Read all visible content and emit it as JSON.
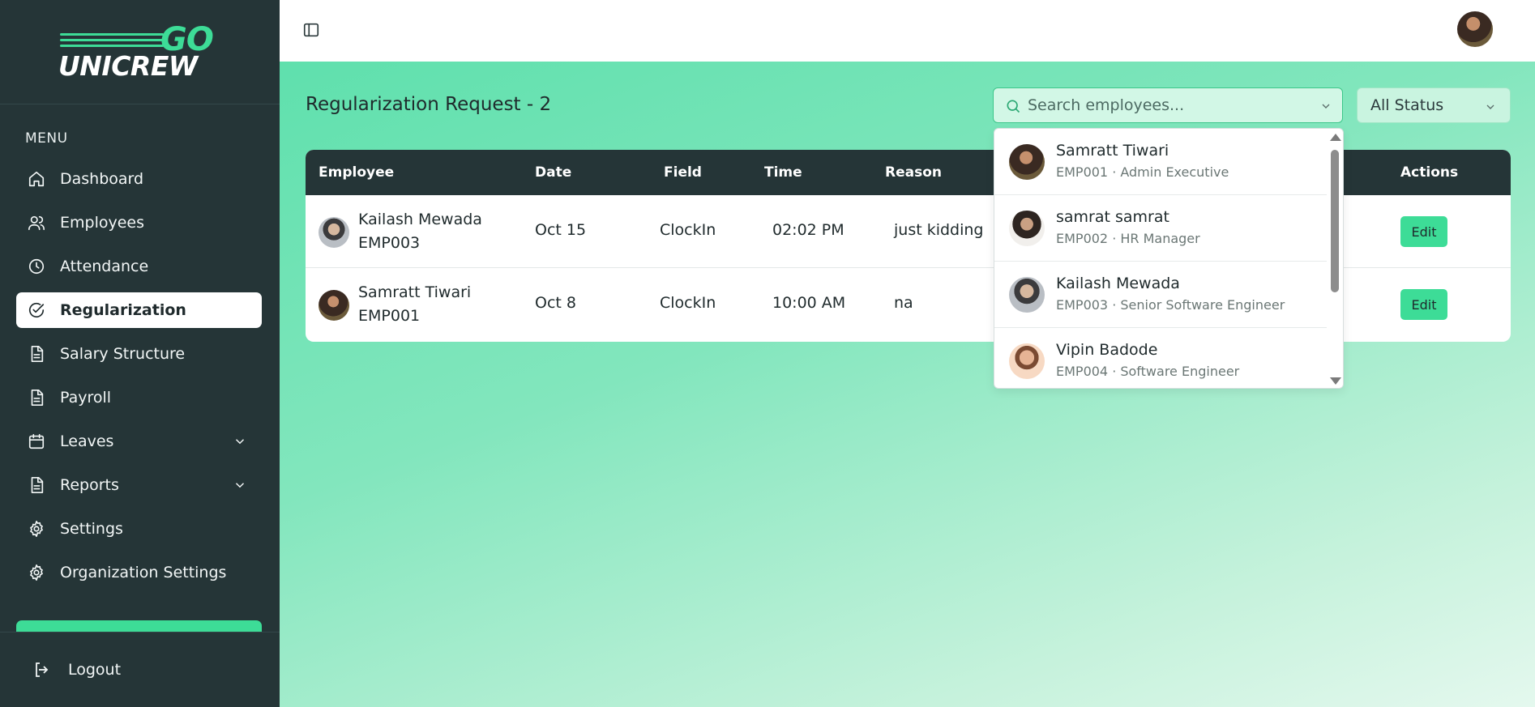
{
  "brand": {
    "logo_go": "GO",
    "logo_name": "UNICREW",
    "accent": "#3ddc97",
    "sidebar_bg": "#253537"
  },
  "sidebar": {
    "menu_label": "MENU",
    "items": [
      {
        "label": "Dashboard",
        "icon": "home-icon",
        "active": false
      },
      {
        "label": "Employees",
        "icon": "users-icon",
        "active": false
      },
      {
        "label": "Attendance",
        "icon": "clock-icon",
        "active": false
      },
      {
        "label": "Regularization",
        "icon": "check-circle-icon",
        "active": true
      },
      {
        "label": "Salary Structure",
        "icon": "document-icon",
        "active": false
      },
      {
        "label": "Payroll",
        "icon": "document-icon",
        "active": false
      },
      {
        "label": "Leaves",
        "icon": "calendar-icon",
        "active": false,
        "expandable": true
      },
      {
        "label": "Reports",
        "icon": "document-icon",
        "active": false,
        "expandable": true
      },
      {
        "label": "Settings",
        "icon": "gear-icon",
        "active": false
      },
      {
        "label": "Organization Settings",
        "icon": "gear-icon",
        "active": false
      }
    ],
    "logout_label": "Logout"
  },
  "header": {
    "page_title": "Regularization Request - 2"
  },
  "search": {
    "placeholder": "Search employees..."
  },
  "status_filter": {
    "selected": "All Status"
  },
  "table": {
    "columns": [
      "Employee",
      "Date",
      "Field",
      "Time",
      "Reason",
      "Actions"
    ],
    "rows": [
      {
        "name": "Kailash Mewada",
        "id": "EMP003",
        "date": "Oct 15",
        "field": "ClockIn",
        "time": "02:02 PM",
        "reason": "just kidding",
        "action": "Edit"
      },
      {
        "name": "Samratt Tiwari",
        "id": "EMP001",
        "date": "Oct 8",
        "field": "ClockIn",
        "time": "10:00 AM",
        "reason": "na",
        "action": "Edit"
      }
    ]
  },
  "employee_dropdown": [
    {
      "name": "Samratt Tiwari",
      "sub": "EMP001 · Admin Executive"
    },
    {
      "name": "samrat samrat",
      "sub": "EMP002 · HR Manager"
    },
    {
      "name": "Kailash Mewada",
      "sub": "EMP003 · Senior Software Engineer"
    },
    {
      "name": "Vipin Badode",
      "sub": "EMP004 · Software Engineer"
    }
  ]
}
